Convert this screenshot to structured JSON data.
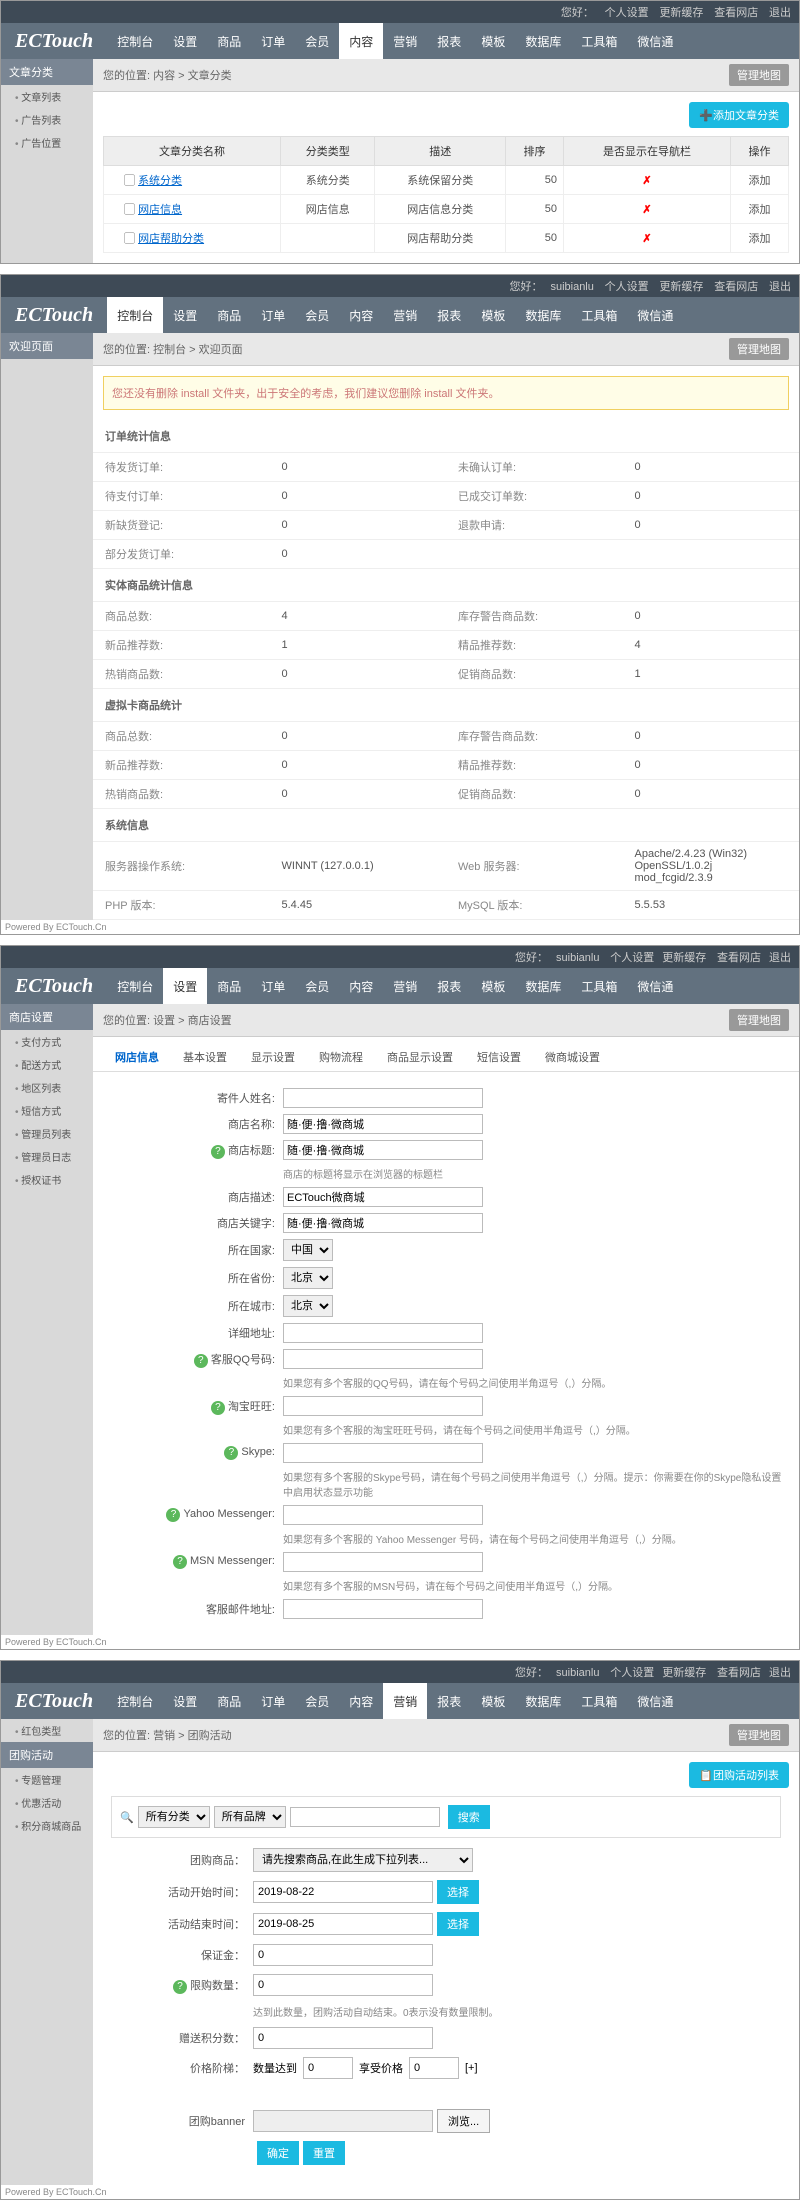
{
  "logo": "ECTouch",
  "greetPrefix": "您好：",
  "user": "suibianlu",
  "topLinks": [
    "个人设置",
    "更新缓存",
    "查看网店",
    "退出"
  ],
  "nav": [
    "控制台",
    "设置",
    "商品",
    "订单",
    "会员",
    "内容",
    "营销",
    "报表",
    "模板",
    "数据库",
    "工具箱",
    "微信通"
  ],
  "manageMap": "管理地图",
  "p1": {
    "activeNav": 5,
    "crumb": "您的位置: 内容 > 文章分类",
    "side": {
      "title": "文章分类",
      "items": [
        "文章列表",
        "广告列表",
        "广告位置"
      ]
    },
    "addBtn": "➕添加文章分类",
    "headers": [
      "文章分类名称",
      "分类类型",
      "描述",
      "排序",
      "是否显示在导航栏",
      "操作"
    ],
    "rows": [
      {
        "name": "系统分类",
        "type": "系统分类",
        "desc": "系统保留分类",
        "sort": "50",
        "op": "添加"
      },
      {
        "name": "网店信息",
        "type": "网店信息",
        "desc": "网店信息分类",
        "sort": "50",
        "op": "添加"
      },
      {
        "name": "网店帮助分类",
        "type": "",
        "desc": "网店帮助分类",
        "sort": "50",
        "op": "添加"
      }
    ]
  },
  "p2": {
    "activeNav": 0,
    "crumb": "您的位置: 控制台 > 欢迎页面",
    "side": {
      "title": "欢迎页面"
    },
    "warn": "您还没有删除 install 文件夹，出于安全的考虑，我们建议您删除 install 文件夹。",
    "s1": {
      "title": "订单统计信息",
      "rows": [
        [
          "待发货订单:",
          "0",
          "未确认订单:",
          "0"
        ],
        [
          "待支付订单:",
          "0",
          "已成交订单数:",
          "0"
        ],
        [
          "新缺货登记:",
          "0",
          "退款申请:",
          "0"
        ],
        [
          "部分发货订单:",
          "0",
          "",
          ""
        ]
      ]
    },
    "s2": {
      "title": "实体商品统计信息",
      "rows": [
        [
          "商品总数:",
          "4",
          "库存警告商品数:",
          "0"
        ],
        [
          "新品推荐数:",
          "1",
          "精品推荐数:",
          "4"
        ],
        [
          "热销商品数:",
          "0",
          "促销商品数:",
          "1"
        ]
      ]
    },
    "s3": {
      "title": "虚拟卡商品统计",
      "rows": [
        [
          "商品总数:",
          "0",
          "库存警告商品数:",
          "0"
        ],
        [
          "新品推荐数:",
          "0",
          "精品推荐数:",
          "0"
        ],
        [
          "热销商品数:",
          "0",
          "促销商品数:",
          "0"
        ]
      ]
    },
    "s4": {
      "title": "系统信息",
      "rows": [
        [
          "服务器操作系统:",
          "WINNT (127.0.0.1)",
          "Web 服务器:",
          "Apache/2.4.23 (Win32) OpenSSL/1.0.2j mod_fcgid/2.3.9"
        ],
        [
          "PHP 版本:",
          "5.4.45",
          "MySQL 版本:",
          "5.5.53"
        ]
      ]
    }
  },
  "p3": {
    "activeNav": 1,
    "crumb": "您的位置: 设置 > 商店设置",
    "side": {
      "title": "商店设置",
      "items": [
        "支付方式",
        "配送方式",
        "地区列表",
        "短信方式",
        "管理员列表",
        "管理员日志",
        "授权证书"
      ]
    },
    "tabs": [
      "网店信息",
      "基本设置",
      "显示设置",
      "购物流程",
      "商品显示设置",
      "短信设置",
      "微商城设置"
    ],
    "fields": {
      "recipient": {
        "lbl": "寄件人姓名:",
        "val": ""
      },
      "shopName": {
        "lbl": "商店名称:",
        "val": "随·便·撸·微商城"
      },
      "shopTitle": {
        "lbl": "商店标题:",
        "val": "随·便·撸·微商城",
        "hint": "商店的标题将显示在浏览器的标题栏"
      },
      "shopDesc": {
        "lbl": "商店描述:",
        "val": "ECTouch微商城"
      },
      "shopKw": {
        "lbl": "商店关键字:",
        "val": "随·便·撸·微商城"
      },
      "country": {
        "lbl": "所在国家:",
        "val": "中国"
      },
      "province": {
        "lbl": "所在省份:",
        "val": "北京"
      },
      "city": {
        "lbl": "所在城市:",
        "val": "北京"
      },
      "addr": {
        "lbl": "详细地址:",
        "val": ""
      },
      "qq": {
        "lbl": "客服QQ号码:",
        "val": "",
        "hint": "如果您有多个客服的QQ号码，请在每个号码之间使用半角逗号（,）分隔。"
      },
      "ww": {
        "lbl": "淘宝旺旺:",
        "val": "",
        "hint": "如果您有多个客服的淘宝旺旺号码，请在每个号码之间使用半角逗号（,）分隔。"
      },
      "skype": {
        "lbl": "Skype:",
        "val": "",
        "hint": "如果您有多个客服的Skype号码，请在每个号码之间使用半角逗号（,）分隔。提示：你需要在你的Skype隐私设置中启用状态显示功能"
      },
      "yahoo": {
        "lbl": "Yahoo Messenger:",
        "val": "",
        "hint": "如果您有多个客服的 Yahoo Messenger 号码，请在每个号码之间使用半角逗号（,）分隔。"
      },
      "msn": {
        "lbl": "MSN Messenger:",
        "val": "",
        "hint": "如果您有多个客服的MSN号码，请在每个号码之间使用半角逗号（,）分隔。"
      },
      "email": {
        "lbl": "客服邮件地址:",
        "val": ""
      }
    }
  },
  "p4": {
    "activeNav": 6,
    "crumb": "您的位置: 营销 > 团购活动",
    "side": {
      "items": [
        "红包类型",
        "团购活动",
        "专题管理",
        "优惠活动",
        "积分商城商品"
      ],
      "active": 1
    },
    "listBtn": "📋团购活动列表",
    "search": {
      "cat": "所有分类",
      "brand": "所有品牌",
      "btn": "搜索"
    },
    "form": {
      "goods": {
        "lbl": "团购商品：",
        "ph": "请先搜索商品,在此生成下拉列表..."
      },
      "start": {
        "lbl": "活动开始时间：",
        "val": "2019-08-22",
        "btn": "选择"
      },
      "end": {
        "lbl": "活动结束时间：",
        "val": "2019-08-25",
        "btn": "选择"
      },
      "deposit": {
        "lbl": "保证金：",
        "val": "0"
      },
      "limit": {
        "lbl": "限购数量：",
        "val": "0",
        "hint": "达到此数量，团购活动自动结束。0表示没有数量限制。"
      },
      "points": {
        "lbl": "赠送积分数：",
        "val": "0"
      },
      "ladder": {
        "lbl": "价格阶梯：",
        "q": "数量达到",
        "qv": "0",
        "p": "享受价格",
        "pv": "0",
        "add": "[+]"
      },
      "banner": {
        "lbl": "团购banner",
        "browse": "浏览..."
      },
      "ok": "确定",
      "reset": "重置"
    }
  },
  "poweredBy": "Powered By ECTouch.Cn"
}
